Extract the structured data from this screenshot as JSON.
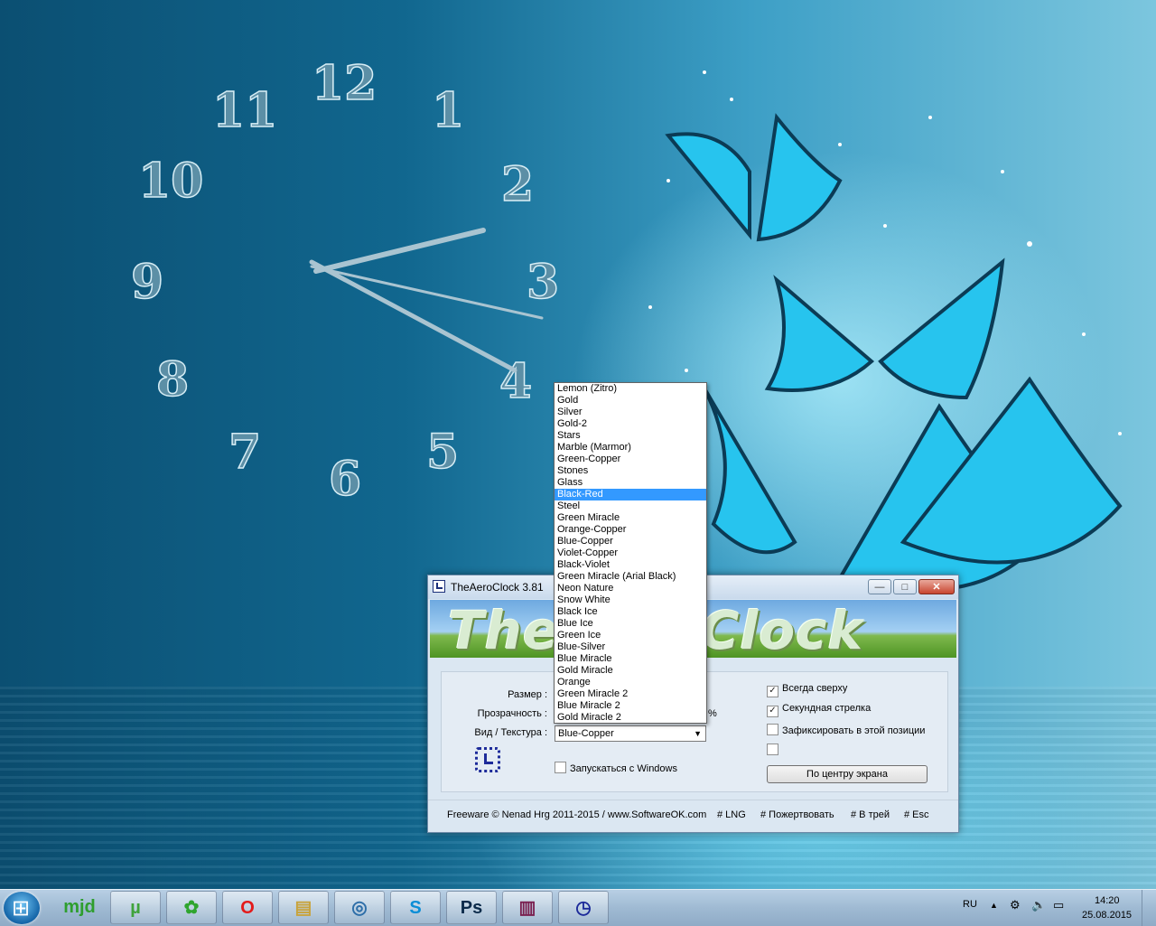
{
  "clock": {
    "numbers": [
      "12",
      "1",
      "2",
      "3",
      "4",
      "5",
      "6",
      "7",
      "8",
      "9",
      "10",
      "11"
    ]
  },
  "window": {
    "title": "TheAeroClock 3.81",
    "banner": "TheAeroClock",
    "controls": {
      "minimize": "—",
      "maximize": "□",
      "close": "✕"
    },
    "labels": {
      "size": "Размер :",
      "transparency": "Прозрачность :",
      "texture": "Вид / Текстура :",
      "percent": "%"
    },
    "select_value": "Blue-Copper",
    "autostart": "Запускаться с Windows",
    "checkboxes": [
      {
        "label": "Всегда сверху",
        "checked": true
      },
      {
        "label": "Секундная стрелка",
        "checked": true
      },
      {
        "label": "Зафиксировать в этой позиции",
        "checked": false
      },
      {
        "label": "",
        "checked": false
      }
    ],
    "center_button": "По центру экрана",
    "footer": {
      "copyright": "Freeware © Nenad Hrg 2011-2015 / www.SoftwareOK.com",
      "lng": "# LNG",
      "donate": "# Пожертвовать",
      "tray": "# В трей",
      "esc": "# Esc"
    }
  },
  "dropdown": {
    "options": [
      "Lemon (Zitro)",
      "Gold",
      "Silver",
      "Gold-2",
      "Stars",
      "Marble (Marmor)",
      "Green-Copper",
      "Stones",
      "Glass",
      "Black-Red",
      "Steel",
      "Green Miracle",
      "Orange-Copper",
      "Blue-Copper",
      "Violet-Copper",
      "Black-Violet",
      "Green Miracle (Arial Black)",
      "Neon Nature",
      "Snow White",
      "Black Ice",
      "Blue Ice",
      "Green Ice",
      "Blue-Silver",
      "Blue Miracle",
      "Gold Miracle",
      "Orange",
      "Green Miracle 2",
      "Blue Miracle 2",
      "Gold Miracle 2"
    ],
    "highlighted": "Black-Red"
  },
  "taskbar": {
    "apps": [
      {
        "name": "mjd-icon",
        "label": "mjd"
      },
      {
        "name": "utorrent-icon",
        "label": "µ"
      },
      {
        "name": "icq-icon",
        "label": "✿"
      },
      {
        "name": "opera-icon",
        "label": "O"
      },
      {
        "name": "explorer-icon",
        "label": "▤"
      },
      {
        "name": "browser-icon",
        "label": "◎"
      },
      {
        "name": "skype-icon",
        "label": "S"
      },
      {
        "name": "photoshop-icon",
        "label": "Ps"
      },
      {
        "name": "winrar-icon",
        "label": "▥"
      },
      {
        "name": "aeroclock-icon",
        "label": "◷"
      }
    ],
    "language": "RU",
    "time": "14:20",
    "date": "25.08.2015"
  }
}
